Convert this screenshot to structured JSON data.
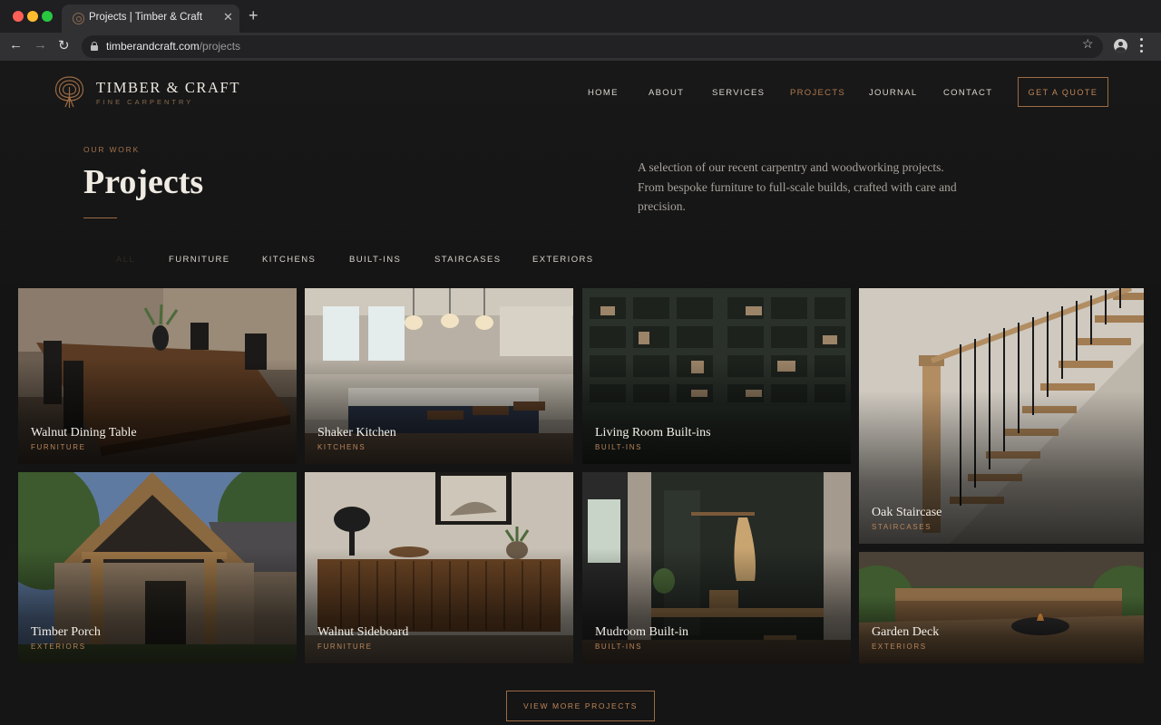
{
  "browser": {
    "tab_title": "Projects | Timber & Craft",
    "tab_close": "✕",
    "new_tab": "+",
    "url_host": "timberandcraft.com",
    "url_path": "/projects",
    "back": "←",
    "forward": "→",
    "reload": "↻",
    "star": "☆"
  },
  "brand": {
    "name": "TIMBER & CRAFT",
    "tagline": "FINE CARPENTRY",
    "accent_color": "#a5724a"
  },
  "nav": {
    "items": [
      {
        "label": "HOME"
      },
      {
        "label": "ABOUT"
      },
      {
        "label": "SERVICES"
      },
      {
        "label": "PROJECTS",
        "active": true
      },
      {
        "label": "JOURNAL"
      },
      {
        "label": "CONTACT"
      }
    ],
    "cta": "GET A QUOTE"
  },
  "hero": {
    "eyebrow": "OUR WORK",
    "title": "Projects",
    "intro": "A selection of our recent carpentry and woodworking projects. From bespoke furniture to full-scale builds, crafted with care and precision."
  },
  "filters": [
    {
      "label": "ALL",
      "active": true
    },
    {
      "label": "FURNITURE"
    },
    {
      "label": "KITCHENS"
    },
    {
      "label": "BUILT-INS"
    },
    {
      "label": "STAIRCASES"
    },
    {
      "label": "EXTERIORS"
    }
  ],
  "projects": [
    {
      "title": "Walnut Dining Table",
      "category": "FURNITURE"
    },
    {
      "title": "Shaker Kitchen",
      "category": "KITCHENS"
    },
    {
      "title": "Living Room Built-ins",
      "category": "BUILT-INS"
    },
    {
      "title": "Oak Staircase",
      "category": "STAIRCASES"
    },
    {
      "title": "Timber Porch",
      "category": "EXTERIORS"
    },
    {
      "title": "Walnut Sideboard",
      "category": "FURNITURE"
    },
    {
      "title": "Mudroom Built-in",
      "category": "BUILT-INS"
    },
    {
      "title": "Garden Deck",
      "category": "EXTERIORS"
    }
  ],
  "view_more": "VIEW MORE PROJECTS"
}
